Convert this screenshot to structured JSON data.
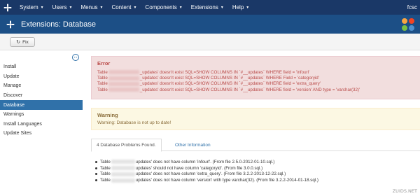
{
  "navbar": {
    "menu": [
      "System",
      "Users",
      "Menus",
      "Content",
      "Components",
      "Extensions",
      "Help"
    ],
    "user_text": "fcsc"
  },
  "header": {
    "title": "Extensions: Database"
  },
  "toolbar": {
    "fix_label": "Fix"
  },
  "sidebar": {
    "items": [
      "Install",
      "Update",
      "Manage",
      "Discover",
      "Database",
      "Warnings",
      "Install Languages",
      "Update Sites"
    ],
    "active_index": 4
  },
  "error_alert": {
    "heading": "Error",
    "lines": [
      {
        "prefix": "Table",
        "text": "_updates' doesn't exist SQL=SHOW COLUMNS IN `#__updates` WHERE field = 'infourl'"
      },
      {
        "prefix": "Table",
        "text": "_updates' doesn't exist SQL=SHOW COLUMNS IN `#__updates` WHERE Field = 'categoryid'"
      },
      {
        "prefix": "Table",
        "text": "_updates' doesn't exist SQL=SHOW COLUMNS IN `#__updates` WHERE field = 'extra_query'"
      },
      {
        "prefix": "Table",
        "text": "_updates' doesn't exist SQL=SHOW COLUMNS IN `#__updates` WHERE field = 'version' AND type = 'varchar(32)'"
      }
    ]
  },
  "warning_alert": {
    "heading": "Warning",
    "text": "Warning: Database is not up to date!"
  },
  "tabs": [
    "4 Database Problems Found.",
    "Other Information"
  ],
  "problems": [
    {
      "prefix": "Table",
      "text": "updates' does not have column 'infourl'. (From file 2.5.0-2012-01-10.sql.)"
    },
    {
      "prefix": "Table",
      "text": "updates' should not have column 'categoryid'. (From file 3.0.0.sql.)"
    },
    {
      "prefix": "Table",
      "text": "updates' does not have column 'extra_query'. (From file 3.2.2-2013-12-22.sql.)"
    },
    {
      "prefix": "Table",
      "text": "updates' does not have column 'version' with type varchar(32). (From file 3.2.2-2014-01-18.sql.)"
    }
  ],
  "watermark": "ZUIDS.NET",
  "colors": {
    "navbar": "#1a3867",
    "header": "#1c4f86",
    "active_sidebar": "#3071a9",
    "error_bg": "#f2dede",
    "error_text": "#b94a48",
    "warning_bg": "#fcf8e3",
    "warning_text": "#8a6d3b",
    "link": "#3071a9"
  },
  "icons": {
    "brand": "joomla-logo-icon",
    "header": "joomla-puzzle-icon",
    "fix": "refresh-icon",
    "sidebar_toggle": "toggle-sidebar-icon"
  }
}
